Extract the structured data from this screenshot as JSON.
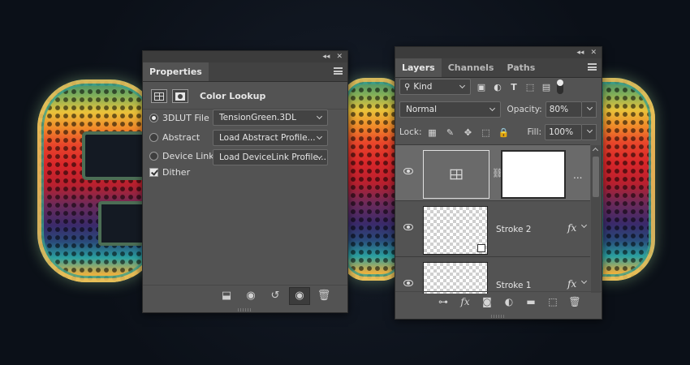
{
  "properties_panel": {
    "tab": "Properties",
    "title": "Color Lookup",
    "options": [
      {
        "label": "3DLUT File",
        "type": "radio",
        "selected": true,
        "value": "TensionGreen.3DL"
      },
      {
        "label": "Abstract",
        "type": "radio",
        "selected": false,
        "value": "Load Abstract Profile..."
      },
      {
        "label": "Device Link",
        "type": "radio",
        "selected": false,
        "value": "Load DeviceLink Profile..."
      },
      {
        "label": "Dither",
        "type": "checkbox",
        "checked": true
      }
    ],
    "footer_icons": [
      "clip-to-layer-icon",
      "view-previous-state-icon",
      "reset-icon",
      "visibility-eye-icon",
      "trash-icon"
    ]
  },
  "layers_panel": {
    "tabs": [
      "Layers",
      "Channels",
      "Paths"
    ],
    "active_tab": "Layers",
    "filter": {
      "kind_label": "Kind"
    },
    "blend_mode": "Normal",
    "opacity_label": "Opacity:",
    "opacity": "80%",
    "lock_label": "Lock:",
    "fill_label": "Fill:",
    "fill": "100%",
    "layers": [
      {
        "type": "adjustment",
        "name": "",
        "selected": true,
        "visible": true
      },
      {
        "type": "smart-object",
        "name": "Stroke 2",
        "visible": true,
        "fx": "fx"
      },
      {
        "type": "smart-object",
        "name": "Stroke 1",
        "visible": true,
        "fx": "fx"
      }
    ],
    "more_label": "...",
    "footer_icons": [
      "link-layers-icon",
      "fx-icon",
      "add-mask-icon",
      "adjustment-layer-icon",
      "folder-icon",
      "new-layer-icon",
      "trash-icon"
    ]
  },
  "colors": {
    "panel_bg": "#535353",
    "tab_bar": "#424242",
    "selected_layer": "#6a6a6a",
    "canvas_bg": "#0c1119"
  }
}
